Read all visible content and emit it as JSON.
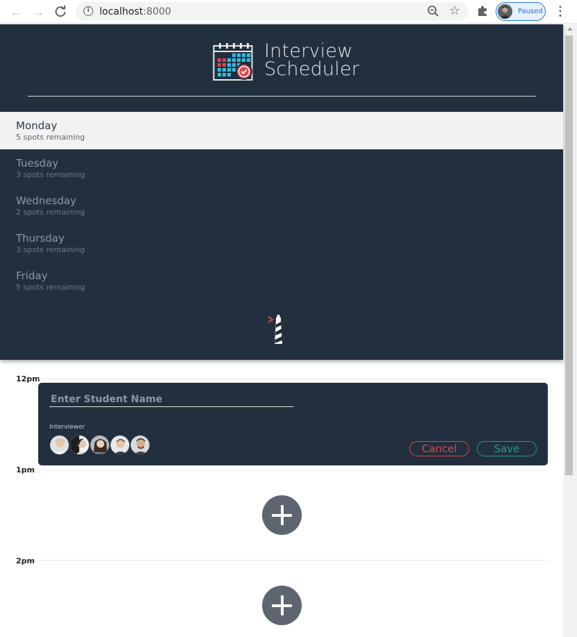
{
  "browser": {
    "url_host": "localhost",
    "url_port": ":8000",
    "profile_status": "Paused"
  },
  "app": {
    "title_line1": "Interview",
    "title_line2": "Scheduler"
  },
  "days": [
    {
      "name": "Monday",
      "spots": "5 spots remaining",
      "selected": true
    },
    {
      "name": "Tuesday",
      "spots": "3 spots remaining",
      "selected": false
    },
    {
      "name": "Wednesday",
      "spots": "2 spots remaining",
      "selected": false
    },
    {
      "name": "Thursday",
      "spots": "3 spots remaining",
      "selected": false
    },
    {
      "name": "Friday",
      "spots": "5 spots remaining",
      "selected": false
    }
  ],
  "schedule": {
    "times": [
      "12pm",
      "1pm",
      "2pm"
    ],
    "form": {
      "student_placeholder": "Enter Student Name",
      "student_value": "",
      "interviewer_label": "Interviewer",
      "cancel_label": "Cancel",
      "save_label": "Save"
    }
  },
  "colors": {
    "sidebar_bg": "#222f3e",
    "cancel": "#e0434f",
    "save": "#1f9d85",
    "add_button": "#5d6670"
  }
}
